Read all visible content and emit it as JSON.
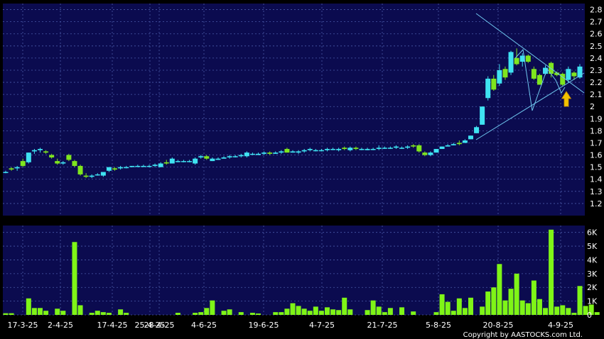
{
  "colors": {
    "background": "#000000",
    "panel": "#0b0b4f",
    "grid": "#4a5aa8",
    "up": "#3fe3f2",
    "down": "#7fe61e",
    "volume": "#7ff517",
    "trendline": "#6fc7ee",
    "arrow": "#f2c200"
  },
  "icons": {
    "signal": "up-arrow-icon"
  },
  "copyright": "Copyright by AASTOCKS.com Ltd.",
  "chart_data": [
    {
      "type": "candlestick",
      "title": "",
      "ylim": [
        1.1,
        2.85
      ],
      "y_ticks": [
        "2.8",
        "2.7",
        "2.6",
        "2.5",
        "2.4",
        "2.3",
        "2.2",
        "2.1",
        "2",
        "1.9",
        "1.8",
        "1.7",
        "1.6",
        "1.5",
        "1.4",
        "1.3",
        "1.2"
      ],
      "x_ticks": [
        "17-3-25",
        "2-4-25",
        "17-4-25",
        "25-4-25",
        "28-4-25",
        "4-6-25",
        "19-6-25",
        "4-7-25",
        "21-7-25",
        "5-8-25",
        "20-8-25",
        "4-9-25"
      ],
      "grid": true,
      "candles": [
        {
          "o": 1.46,
          "h": 1.47,
          "l": 1.45,
          "c": 1.46
        },
        {
          "o": 1.49,
          "h": 1.5,
          "l": 1.47,
          "c": 1.48
        },
        {
          "o": 1.49,
          "h": 1.51,
          "l": 1.47,
          "c": 1.5
        },
        {
          "o": 1.55,
          "h": 1.57,
          "l": 1.5,
          "c": 1.51
        },
        {
          "o": 1.54,
          "h": 1.62,
          "l": 1.53,
          "c": 1.62
        },
        {
          "o": 1.63,
          "h": 1.65,
          "l": 1.61,
          "c": 1.64
        },
        {
          "o": 1.64,
          "h": 1.66,
          "l": 1.62,
          "c": 1.65
        },
        {
          "o": 1.63,
          "h": 1.64,
          "l": 1.61,
          "c": 1.62
        },
        {
          "o": 1.6,
          "h": 1.61,
          "l": 1.57,
          "c": 1.58
        },
        {
          "o": 1.55,
          "h": 1.57,
          "l": 1.52,
          "c": 1.53
        },
        {
          "o": 1.53,
          "h": 1.55,
          "l": 1.52,
          "c": 1.54
        },
        {
          "o": 1.6,
          "h": 1.61,
          "l": 1.55,
          "c": 1.56
        },
        {
          "o": 1.55,
          "h": 1.56,
          "l": 1.5,
          "c": 1.51
        },
        {
          "o": 1.51,
          "h": 1.52,
          "l": 1.43,
          "c": 1.44
        },
        {
          "o": 1.43,
          "h": 1.45,
          "l": 1.41,
          "c": 1.42
        },
        {
          "o": 1.42,
          "h": 1.44,
          "l": 1.41,
          "c": 1.43
        },
        {
          "o": 1.44,
          "h": 1.45,
          "l": 1.43,
          "c": 1.44
        },
        {
          "o": 1.43,
          "h": 1.46,
          "l": 1.42,
          "c": 1.46
        },
        {
          "o": 1.47,
          "h": 1.5,
          "l": 1.46,
          "c": 1.5
        },
        {
          "o": 1.49,
          "h": 1.5,
          "l": 1.47,
          "c": 1.48
        },
        {
          "o": 1.49,
          "h": 1.51,
          "l": 1.48,
          "c": 1.5
        },
        {
          "o": 1.5,
          "h": 1.51,
          "l": 1.49,
          "c": 1.5
        },
        {
          "o": 1.5,
          "h": 1.51,
          "l": 1.5,
          "c": 1.51
        },
        {
          "o": 1.51,
          "h": 1.52,
          "l": 1.5,
          "c": 1.51
        },
        {
          "o": 1.51,
          "h": 1.52,
          "l": 1.5,
          "c": 1.51
        },
        {
          "o": 1.51,
          "h": 1.52,
          "l": 1.5,
          "c": 1.51
        },
        {
          "o": 1.51,
          "h": 1.53,
          "l": 1.5,
          "c": 1.52
        },
        {
          "o": 1.5,
          "h": 1.54,
          "l": 1.5,
          "c": 1.53
        },
        {
          "o": 1.54,
          "h": 1.56,
          "l": 1.52,
          "c": 1.53
        },
        {
          "o": 1.53,
          "h": 1.58,
          "l": 1.53,
          "c": 1.57
        },
        {
          "o": 1.55,
          "h": 1.56,
          "l": 1.54,
          "c": 1.55
        },
        {
          "o": 1.55,
          "h": 1.56,
          "l": 1.54,
          "c": 1.55
        },
        {
          "o": 1.55,
          "h": 1.56,
          "l": 1.54,
          "c": 1.55
        },
        {
          "o": 1.53,
          "h": 1.58,
          "l": 1.52,
          "c": 1.57
        },
        {
          "o": 1.58,
          "h": 1.6,
          "l": 1.57,
          "c": 1.59
        },
        {
          "o": 1.59,
          "h": 1.6,
          "l": 1.56,
          "c": 1.57
        },
        {
          "o": 1.55,
          "h": 1.58,
          "l": 1.55,
          "c": 1.57
        },
        {
          "o": 1.56,
          "h": 1.58,
          "l": 1.56,
          "c": 1.57
        },
        {
          "o": 1.57,
          "h": 1.59,
          "l": 1.57,
          "c": 1.58
        },
        {
          "o": 1.58,
          "h": 1.6,
          "l": 1.57,
          "c": 1.59
        },
        {
          "o": 1.59,
          "h": 1.6,
          "l": 1.58,
          "c": 1.59
        },
        {
          "o": 1.59,
          "h": 1.61,
          "l": 1.58,
          "c": 1.6
        },
        {
          "o": 1.59,
          "h": 1.63,
          "l": 1.58,
          "c": 1.62
        },
        {
          "o": 1.61,
          "h": 1.62,
          "l": 1.6,
          "c": 1.61
        },
        {
          "o": 1.6,
          "h": 1.62,
          "l": 1.6,
          "c": 1.61
        },
        {
          "o": 1.61,
          "h": 1.63,
          "l": 1.6,
          "c": 1.62
        },
        {
          "o": 1.62,
          "h": 1.63,
          "l": 1.6,
          "c": 1.61
        },
        {
          "o": 1.61,
          "h": 1.63,
          "l": 1.61,
          "c": 1.62
        },
        {
          "o": 1.62,
          "h": 1.64,
          "l": 1.61,
          "c": 1.63
        },
        {
          "o": 1.65,
          "h": 1.66,
          "l": 1.62,
          "c": 1.62
        },
        {
          "o": 1.62,
          "h": 1.64,
          "l": 1.62,
          "c": 1.63
        },
        {
          "o": 1.62,
          "h": 1.64,
          "l": 1.61,
          "c": 1.63
        },
        {
          "o": 1.63,
          "h": 1.65,
          "l": 1.62,
          "c": 1.64
        },
        {
          "o": 1.64,
          "h": 1.66,
          "l": 1.63,
          "c": 1.65
        },
        {
          "o": 1.64,
          "h": 1.65,
          "l": 1.63,
          "c": 1.64
        },
        {
          "o": 1.64,
          "h": 1.65,
          "l": 1.63,
          "c": 1.64
        },
        {
          "o": 1.64,
          "h": 1.66,
          "l": 1.63,
          "c": 1.65
        },
        {
          "o": 1.65,
          "h": 1.66,
          "l": 1.64,
          "c": 1.65
        },
        {
          "o": 1.64,
          "h": 1.66,
          "l": 1.63,
          "c": 1.65
        },
        {
          "o": 1.66,
          "h": 1.67,
          "l": 1.64,
          "c": 1.65
        },
        {
          "o": 1.64,
          "h": 1.67,
          "l": 1.63,
          "c": 1.66
        },
        {
          "o": 1.66,
          "h": 1.67,
          "l": 1.64,
          "c": 1.65
        },
        {
          "o": 1.65,
          "h": 1.66,
          "l": 1.64,
          "c": 1.65
        },
        {
          "o": 1.64,
          "h": 1.66,
          "l": 1.64,
          "c": 1.65
        },
        {
          "o": 1.65,
          "h": 1.66,
          "l": 1.64,
          "c": 1.65
        },
        {
          "o": 1.65,
          "h": 1.68,
          "l": 1.64,
          "c": 1.66
        },
        {
          "o": 1.66,
          "h": 1.67,
          "l": 1.65,
          "c": 1.66
        },
        {
          "o": 1.66,
          "h": 1.67,
          "l": 1.65,
          "c": 1.66
        },
        {
          "o": 1.66,
          "h": 1.68,
          "l": 1.65,
          "c": 1.67
        },
        {
          "o": 1.66,
          "h": 1.67,
          "l": 1.65,
          "c": 1.66
        },
        {
          "o": 1.66,
          "h": 1.68,
          "l": 1.65,
          "c": 1.67
        },
        {
          "o": 1.68,
          "h": 1.69,
          "l": 1.66,
          "c": 1.67
        },
        {
          "o": 1.68,
          "h": 1.69,
          "l": 1.62,
          "c": 1.63
        },
        {
          "o": 1.62,
          "h": 1.63,
          "l": 1.59,
          "c": 1.6
        },
        {
          "o": 1.6,
          "h": 1.63,
          "l": 1.59,
          "c": 1.62
        },
        {
          "o": 1.62,
          "h": 1.65,
          "l": 1.62,
          "c": 1.65
        },
        {
          "o": 1.65,
          "h": 1.67,
          "l": 1.65,
          "c": 1.67
        },
        {
          "o": 1.67,
          "h": 1.69,
          "l": 1.67,
          "c": 1.68
        },
        {
          "o": 1.68,
          "h": 1.7,
          "l": 1.68,
          "c": 1.69
        },
        {
          "o": 1.7,
          "h": 1.72,
          "l": 1.68,
          "c": 1.69
        },
        {
          "o": 1.7,
          "h": 1.73,
          "l": 1.7,
          "c": 1.72
        },
        {
          "o": 1.73,
          "h": 1.76,
          "l": 1.73,
          "c": 1.76
        },
        {
          "o": 1.78,
          "h": 1.84,
          "l": 1.78,
          "c": 1.83
        },
        {
          "o": 1.85,
          "h": 2.0,
          "l": 1.85,
          "c": 2.0
        },
        {
          "o": 2.07,
          "h": 2.25,
          "l": 2.05,
          "c": 2.23
        },
        {
          "o": 2.23,
          "h": 2.26,
          "l": 2.13,
          "c": 2.14
        },
        {
          "o": 2.19,
          "h": 2.35,
          "l": 2.17,
          "c": 2.3
        },
        {
          "o": 2.31,
          "h": 2.33,
          "l": 2.22,
          "c": 2.24
        },
        {
          "o": 2.28,
          "h": 2.46,
          "l": 2.26,
          "c": 2.45
        },
        {
          "o": 2.4,
          "h": 2.48,
          "l": 2.34,
          "c": 2.35
        },
        {
          "o": 2.37,
          "h": 2.44,
          "l": 2.33,
          "c": 2.42
        },
        {
          "o": 2.42,
          "h": 2.43,
          "l": 2.36,
          "c": 2.37
        },
        {
          "o": 2.31,
          "h": 2.33,
          "l": 2.22,
          "c": 2.23
        },
        {
          "o": 2.26,
          "h": 2.27,
          "l": 2.18,
          "c": 2.18
        },
        {
          "o": 2.27,
          "h": 2.34,
          "l": 2.26,
          "c": 2.32
        },
        {
          "o": 2.36,
          "h": 2.37,
          "l": 2.24,
          "c": 2.27
        },
        {
          "o": 2.28,
          "h": 2.29,
          "l": 2.25,
          "c": 2.26
        },
        {
          "o": 2.27,
          "h": 2.28,
          "l": 2.17,
          "c": 2.18
        },
        {
          "o": 2.22,
          "h": 2.33,
          "l": 2.2,
          "c": 2.31
        },
        {
          "o": 2.28,
          "h": 2.29,
          "l": 2.22,
          "c": 2.25
        },
        {
          "o": 2.24,
          "h": 2.35,
          "l": 2.23,
          "c": 2.33
        }
      ]
    },
    {
      "type": "bar",
      "ylim": [
        0,
        6500
      ],
      "y_ticks": [
        "6K",
        "5K",
        "4K",
        "3K",
        "2K",
        "1K",
        "0"
      ],
      "values": [
        120,
        120,
        0,
        0,
        1200,
        500,
        500,
        300,
        0,
        450,
        300,
        0,
        5300,
        700,
        0,
        150,
        300,
        200,
        150,
        0,
        400,
        150,
        0,
        0,
        0,
        0,
        0,
        0,
        0,
        0,
        150,
        0,
        0,
        150,
        200,
        500,
        1050,
        0,
        300,
        400,
        0,
        200,
        0,
        150,
        100,
        0,
        0,
        200,
        200,
        450,
        850,
        650,
        450,
        300,
        600,
        300,
        550,
        400,
        350,
        1250,
        400,
        0,
        0,
        350,
        1050,
        600,
        200,
        500,
        0,
        550,
        0,
        250,
        0,
        0,
        0,
        200,
        1500,
        950,
        300,
        1200,
        500,
        1250,
        0,
        600,
        1700,
        2000,
        3700,
        1050,
        1900,
        3000,
        1050,
        850,
        2500,
        1150,
        500,
        6200,
        600,
        700,
        500,
        150,
        2100,
        650,
        750,
        200
      ]
    }
  ]
}
